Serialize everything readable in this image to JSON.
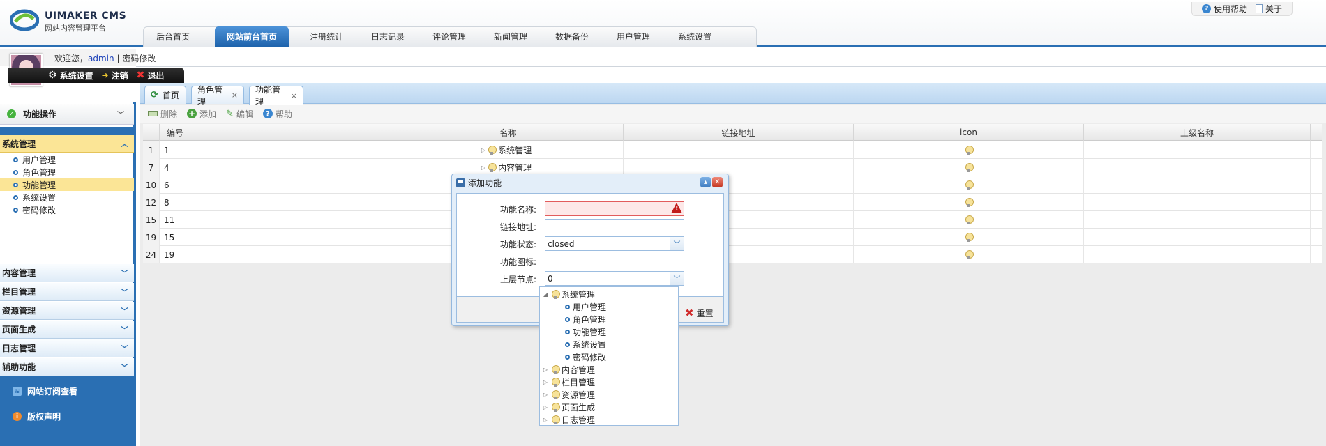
{
  "header": {
    "logo_title": "UIMAKER CMS",
    "logo_sub": "网站内容管理平台",
    "top_links": [
      {
        "icon": "help-icon",
        "label": "使用帮助"
      },
      {
        "icon": "document-icon",
        "label": "关于"
      }
    ],
    "nav_tabs": [
      "后台首页",
      "网站前台首页",
      "注册统计",
      "日志记录",
      "评论管理",
      "新闻管理",
      "数据备份",
      "用户管理",
      "系统设置"
    ],
    "active_nav": "网站前台首页"
  },
  "userbar": {
    "welcome": "欢迎您，",
    "username": "admin",
    "sep": "|",
    "change_password": "密码修改",
    "actions": [
      "系统设置",
      "注销",
      "退出"
    ]
  },
  "sidebar": {
    "head": "功能操作",
    "system_group": "系统管理",
    "system_items": [
      "用户管理",
      "角色管理",
      "功能管理",
      "系统设置",
      "密码修改"
    ],
    "selected_item": "功能管理",
    "groups": [
      "内容管理",
      "栏目管理",
      "资源管理",
      "页面生成",
      "日志管理",
      "辅助功能"
    ],
    "footer": [
      "网站订阅查看",
      "版权声明"
    ]
  },
  "content_tabs": [
    "首页",
    "角色管理",
    "功能管理"
  ],
  "active_tab": "功能管理",
  "toolbar": [
    "删除",
    "添加",
    "编辑",
    "帮助"
  ],
  "grid": {
    "columns": [
      "编号",
      "名称",
      "链接地址",
      "icon",
      "上级名称"
    ],
    "rows": [
      {
        "rownum": "1",
        "id": "1",
        "name": "系统管理"
      },
      {
        "rownum": "7",
        "id": "4",
        "name": "内容管理"
      },
      {
        "rownum": "10",
        "id": "6",
        "name": ""
      },
      {
        "rownum": "12",
        "id": "8",
        "name": ""
      },
      {
        "rownum": "15",
        "id": "11",
        "name": ""
      },
      {
        "rownum": "19",
        "id": "15",
        "name": ""
      },
      {
        "rownum": "24",
        "id": "19",
        "name": ""
      }
    ]
  },
  "dialog": {
    "title": "添加功能",
    "fields": [
      {
        "label": "功能名称:",
        "value": "",
        "error": true
      },
      {
        "label": "链接地址:",
        "value": ""
      },
      {
        "label": "功能状态:",
        "value": "closed",
        "combo": true
      },
      {
        "label": "功能图标:",
        "value": ""
      },
      {
        "label": "上层节点:",
        "value": "0",
        "combo": true
      }
    ],
    "reset_label": "重置"
  },
  "tree": {
    "root": "系统管理",
    "children": [
      "用户管理",
      "角色管理",
      "功能管理",
      "系统设置",
      "密码修改"
    ],
    "collapsed": [
      "内容管理",
      "栏目管理",
      "资源管理",
      "页面生成",
      "日志管理"
    ]
  },
  "colors": {
    "brand_blue": "#2a6fb3",
    "highlight_yellow": "#fbe596",
    "error_red": "#c21b1b"
  }
}
